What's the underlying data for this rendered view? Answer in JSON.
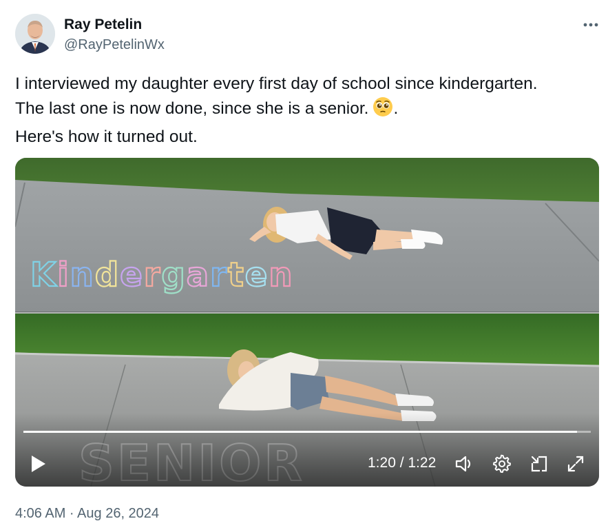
{
  "author": {
    "name": "Ray Petelin",
    "handle": "@RayPetelinWx"
  },
  "post": {
    "lines": [
      "I interviewed my daughter every first day of school since kindergarten.",
      "The last one is now done, since she is a senior.",
      "Here's how it turned out."
    ],
    "emoji_trailing": ".",
    "emoji_icon": "pleading-face-emoji",
    "timestamp": "4:06 AM · Aug 26, 2024"
  },
  "media": {
    "top_chalk_text": "Kindergarten",
    "bottom_chalk_text": "SENIOR",
    "time_display": "1:20 / 1:22",
    "progress_fraction": 0.976
  },
  "icons": {
    "more": "more-horizontal-icon",
    "play": "play-icon",
    "volume": "volume-icon",
    "settings": "settings-gear-icon",
    "dock": "dock-video-icon",
    "fullscreen": "fullscreen-icon"
  }
}
